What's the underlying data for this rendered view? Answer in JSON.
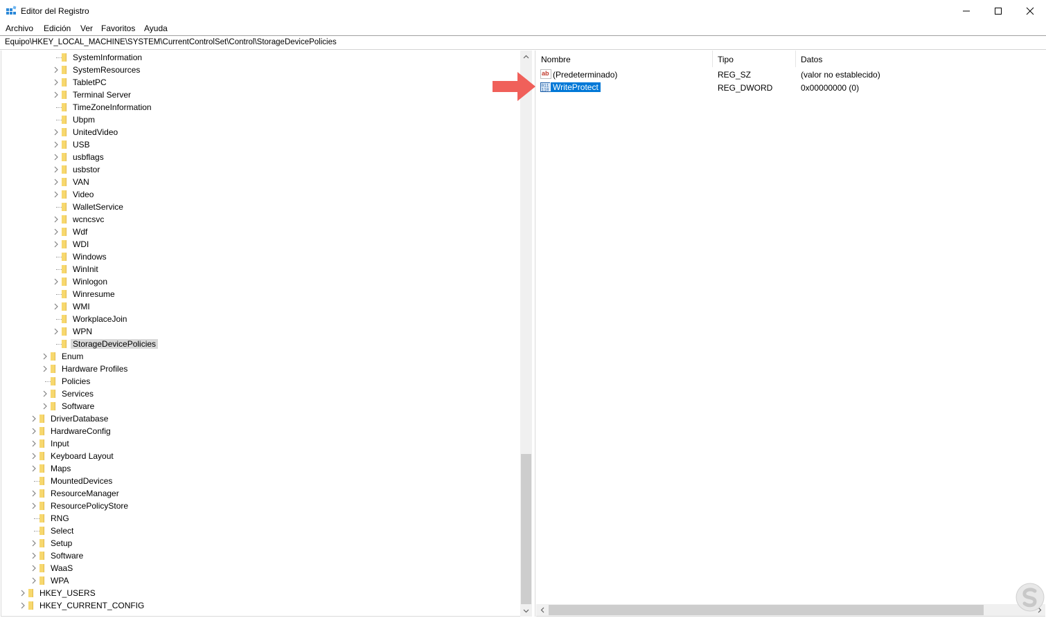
{
  "window": {
    "title": "Editor del Registro",
    "minimize_glyph": "—",
    "maximize_glyph": "☐",
    "close_glyph": "✕"
  },
  "menu": {
    "items": [
      "Archivo",
      "Edición",
      "Ver",
      "Favoritos",
      "Ayuda"
    ]
  },
  "address": {
    "path": "Equipo\\HKEY_LOCAL_MACHINE\\SYSTEM\\CurrentControlSet\\Control\\StorageDevicePolicies"
  },
  "tree": {
    "items": [
      {
        "label": "SystemInformation",
        "level": 3,
        "expandable": false,
        "selected": false
      },
      {
        "label": "SystemResources",
        "level": 3,
        "expandable": true,
        "selected": false
      },
      {
        "label": "TabletPC",
        "level": 3,
        "expandable": true,
        "selected": false
      },
      {
        "label": "Terminal Server",
        "level": 3,
        "expandable": true,
        "selected": false
      },
      {
        "label": "TimeZoneInformation",
        "level": 3,
        "expandable": false,
        "selected": false
      },
      {
        "label": "Ubpm",
        "level": 3,
        "expandable": false,
        "selected": false
      },
      {
        "label": "UnitedVideo",
        "level": 3,
        "expandable": true,
        "selected": false
      },
      {
        "label": "USB",
        "level": 3,
        "expandable": true,
        "selected": false
      },
      {
        "label": "usbflags",
        "level": 3,
        "expandable": true,
        "selected": false
      },
      {
        "label": "usbstor",
        "level": 3,
        "expandable": true,
        "selected": false
      },
      {
        "label": "VAN",
        "level": 3,
        "expandable": true,
        "selected": false
      },
      {
        "label": "Video",
        "level": 3,
        "expandable": true,
        "selected": false
      },
      {
        "label": "WalletService",
        "level": 3,
        "expandable": false,
        "selected": false
      },
      {
        "label": "wcncsvc",
        "level": 3,
        "expandable": true,
        "selected": false
      },
      {
        "label": "Wdf",
        "level": 3,
        "expandable": true,
        "selected": false
      },
      {
        "label": "WDI",
        "level": 3,
        "expandable": true,
        "selected": false
      },
      {
        "label": "Windows",
        "level": 3,
        "expandable": false,
        "selected": false
      },
      {
        "label": "WinInit",
        "level": 3,
        "expandable": false,
        "selected": false
      },
      {
        "label": "Winlogon",
        "level": 3,
        "expandable": true,
        "selected": false
      },
      {
        "label": "Winresume",
        "level": 3,
        "expandable": false,
        "selected": false
      },
      {
        "label": "WMI",
        "level": 3,
        "expandable": true,
        "selected": false
      },
      {
        "label": "WorkplaceJoin",
        "level": 3,
        "expandable": false,
        "selected": false
      },
      {
        "label": "WPN",
        "level": 3,
        "expandable": true,
        "selected": false
      },
      {
        "label": "StorageDevicePolicies",
        "level": 3,
        "expandable": false,
        "selected": true
      },
      {
        "label": "Enum",
        "level": 2,
        "expandable": true,
        "selected": false
      },
      {
        "label": "Hardware Profiles",
        "level": 2,
        "expandable": true,
        "selected": false
      },
      {
        "label": "Policies",
        "level": 2,
        "expandable": false,
        "selected": false
      },
      {
        "label": "Services",
        "level": 2,
        "expandable": true,
        "selected": false
      },
      {
        "label": "Software",
        "level": 2,
        "expandable": true,
        "selected": false
      },
      {
        "label": "DriverDatabase",
        "level": 1,
        "expandable": true,
        "selected": false
      },
      {
        "label": "HardwareConfig",
        "level": 1,
        "expandable": true,
        "selected": false
      },
      {
        "label": "Input",
        "level": 1,
        "expandable": true,
        "selected": false
      },
      {
        "label": "Keyboard Layout",
        "level": 1,
        "expandable": true,
        "selected": false
      },
      {
        "label": "Maps",
        "level": 1,
        "expandable": true,
        "selected": false
      },
      {
        "label": "MountedDevices",
        "level": 1,
        "expandable": false,
        "selected": false
      },
      {
        "label": "ResourceManager",
        "level": 1,
        "expandable": true,
        "selected": false
      },
      {
        "label": "ResourcePolicyStore",
        "level": 1,
        "expandable": true,
        "selected": false
      },
      {
        "label": "RNG",
        "level": 1,
        "expandable": false,
        "selected": false
      },
      {
        "label": "Select",
        "level": 1,
        "expandable": false,
        "selected": false
      },
      {
        "label": "Setup",
        "level": 1,
        "expandable": true,
        "selected": false
      },
      {
        "label": "Software",
        "level": 1,
        "expandable": true,
        "selected": false
      },
      {
        "label": "WaaS",
        "level": 1,
        "expandable": true,
        "selected": false
      },
      {
        "label": "WPA",
        "level": 1,
        "expandable": true,
        "selected": false
      },
      {
        "label": "HKEY_USERS",
        "level": 0,
        "expandable": true,
        "selected": false
      },
      {
        "label": "HKEY_CURRENT_CONFIG",
        "level": 0,
        "expandable": true,
        "selected": false
      }
    ]
  },
  "values": {
    "columns": [
      "Nombre",
      "Tipo",
      "Datos"
    ],
    "rows": [
      {
        "name": "(Predeterminado)",
        "type": "REG_SZ",
        "data": "(valor no establecido)",
        "icon": "string-value-icon",
        "selected": false
      },
      {
        "name": "WriteProtect",
        "type": "REG_DWORD",
        "data": "0x00000000 (0)",
        "icon": "binary-value-icon",
        "selected": true
      }
    ]
  },
  "colors": {
    "selection_blue": "#0078d7",
    "tree_selection": "#d9d9d9",
    "folder": "#f7d86e",
    "annotation_arrow": "#f0605a"
  }
}
